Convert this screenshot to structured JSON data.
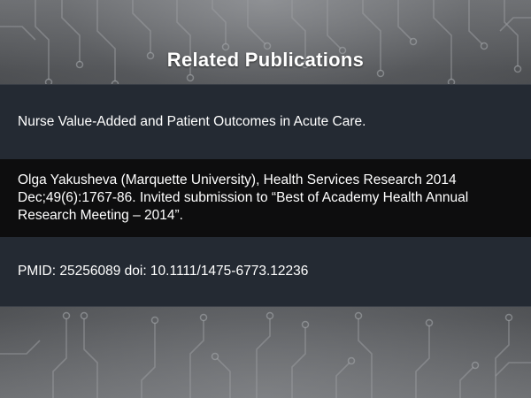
{
  "slide": {
    "title": "Related Publications",
    "publication_title": "Nurse Value-Added and Patient Outcomes in Acute Care.",
    "citation": "Olga Yakusheva (Marquette University), Health Services Research 2014 Dec;49(6):1767-86. Invited submission to “Best of Academy Health Annual Research Meeting – 2014”.",
    "identifiers": "PMID: 25256089 doi: 10.1111/1475-6773.12236"
  },
  "background": {
    "motif": "circuit-board",
    "colors": {
      "base": "#55575a",
      "panel": "#242a33",
      "panel_dark": "#0d0d0e",
      "text": "#ffffff"
    }
  }
}
